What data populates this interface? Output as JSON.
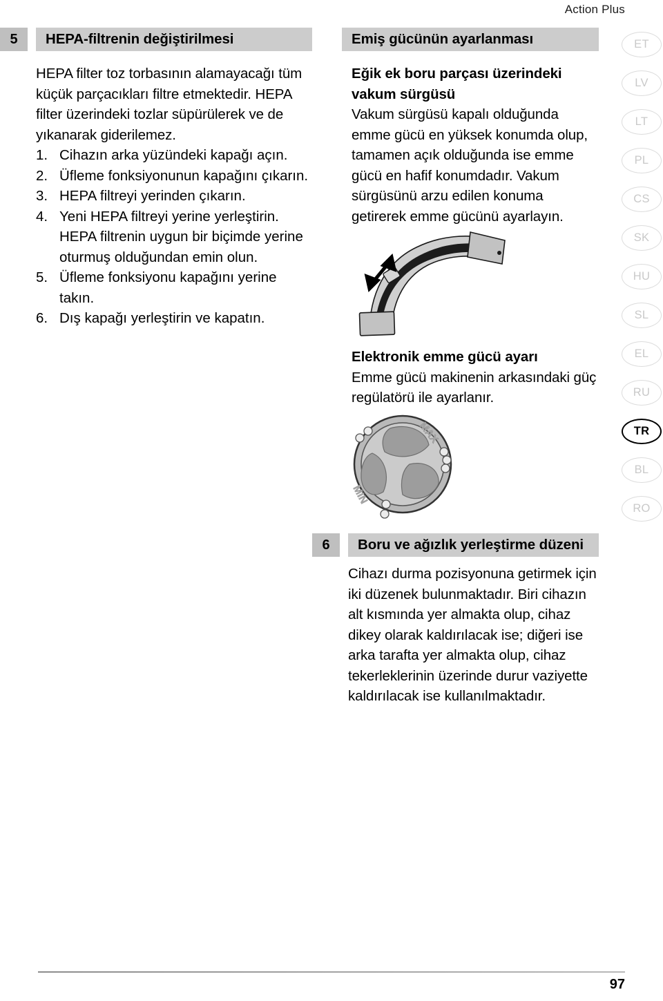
{
  "header": {
    "running_title": "Action Plus"
  },
  "sections": {
    "hepa": {
      "number": "5",
      "title": "HEPA-filtrenin değiştirilmesi",
      "intro": "HEPA filter toz torbasının alamayacağı tüm küçük parçacıkları filtre etmektedir. HEPA filter üzerindeki tozlar süpürülerek ve de yıkanarak giderilemez.",
      "steps": [
        {
          "num": "1.",
          "text": "Cihazın arka yüzündeki kapağı açın."
        },
        {
          "num": "2.",
          "text": "Üfleme fonksiyonunun kapağını çıkarın."
        },
        {
          "num": "3.",
          "text": "HEPA filtreyi yerinden çıkarın."
        },
        {
          "num": "4.",
          "text": "Yeni HEPA filtreyi yerine yerleştirin. HEPA filtrenin uygun bir biçimde yerine oturmuş olduğundan emin olun."
        },
        {
          "num": "5.",
          "text": "Üfleme fonksiyonu kapağını yerine takın."
        },
        {
          "num": "6.",
          "text": "Dış kapağı yerleştirin ve kapatın."
        }
      ]
    },
    "suction": {
      "title": "Emiş gücünün ayarlanması",
      "sub1_heading": "Eğik ek boru parçası üzerindeki vakum sürgüsü",
      "sub1_body": "Vakum sürgüsü kapalı olduğunda emme gücü en yüksek konumda olup, tamamen açık olduğunda ise emme gücü en hafif konumdadır. Vakum sürgüsünü arzu edilen konuma getirerek emme gücünü ayarlayın.",
      "sub2_heading": "Elektronik emme gücü ayarı",
      "sub2_body": "Emme gücü makinenin arkasındaki güç regülatörü ile ayarlanır."
    },
    "tube": {
      "number": "6",
      "title": "Boru ve ağızlık yerleştirme düzeni",
      "body": "Cihazı durma pozisyonuna getirmek için iki düzenek bulunmaktadır. Biri cihazın alt kısmında yer almakta olup, cihaz dikey olarak kaldırılacak ise; diğeri ise arka tarafta yer almakta olup, cihaz tekerleklerinin üzerinde durur vaziyette kaldırılacak ise kullanılmaktadır."
    }
  },
  "figures": {
    "hose": {
      "name": "hose-with-vacuum-slider",
      "arrow_label": ""
    },
    "dial": {
      "name": "power-regulator-dial",
      "min_label": "MIN",
      "max_label": "MAX"
    }
  },
  "language_tabs": [
    {
      "code": "ET",
      "active": false
    },
    {
      "code": "LV",
      "active": false
    },
    {
      "code": "LT",
      "active": false
    },
    {
      "code": "PL",
      "active": false
    },
    {
      "code": "CS",
      "active": false
    },
    {
      "code": "SK",
      "active": false
    },
    {
      "code": "HU",
      "active": false
    },
    {
      "code": "SL",
      "active": false
    },
    {
      "code": "EL",
      "active": false
    },
    {
      "code": "RU",
      "active": false
    },
    {
      "code": "TR",
      "active": true
    },
    {
      "code": "BL",
      "active": false
    },
    {
      "code": "RO",
      "active": false
    }
  ],
  "footer": {
    "page_number": "97"
  },
  "colors": {
    "section_number_bg": "#bfbfbf",
    "section_title_bg": "#cccccc",
    "tab_inactive": "#c9c9c9",
    "tab_active": "#000000",
    "text": "#000000"
  }
}
